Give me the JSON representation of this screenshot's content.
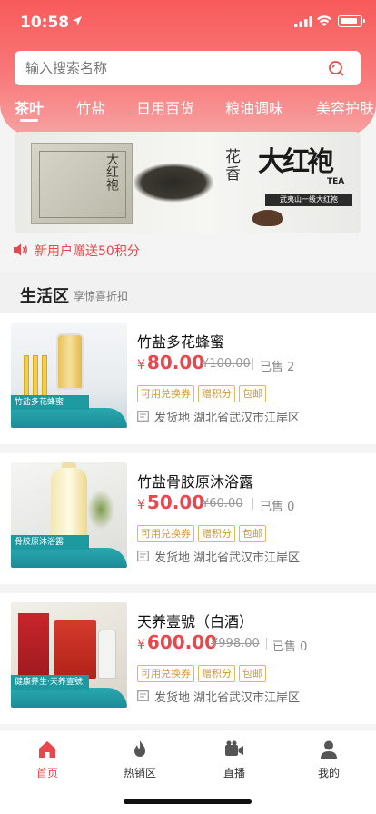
{
  "status_bar": {
    "time": "10:58"
  },
  "search": {
    "placeholder": "输入搜索名称"
  },
  "categories": [
    {
      "label": "茶叶",
      "active": true
    },
    {
      "label": "竹盐",
      "active": false
    },
    {
      "label": "日用百货",
      "active": false
    },
    {
      "label": "粮油调味",
      "active": false
    },
    {
      "label": "美容护肤",
      "active": false
    }
  ],
  "banner": {
    "box_text": "大红袍",
    "hua_text": "花香",
    "calligraphy": "大红袍",
    "tea_text": "TEA",
    "strip_text": "武夷山一级大红袍"
  },
  "promo": {
    "text": "新用户赠送50积分"
  },
  "section": {
    "title": "生活区",
    "subtitle": "享惊喜折扣"
  },
  "products": [
    {
      "name": "竹盐多花蜂蜜",
      "currency": "¥",
      "price": "80.00",
      "old_price": "¥100.00",
      "sold": "已售 2",
      "tags": [
        "可用兑换券",
        "赠积分",
        "包邮"
      ],
      "ship_label": "发货地",
      "ship_location": "湖北省武汉市江岸区",
      "image_caption": "竹盐多花蜂蜜"
    },
    {
      "name": "竹盐骨胶原沐浴露",
      "currency": "¥",
      "price": "50.00",
      "old_price": "¥60.00",
      "sold": "已售 0",
      "tags": [
        "可用兑换券",
        "赠积分",
        "包邮"
      ],
      "ship_label": "发货地",
      "ship_location": "湖北省武汉市江岸区",
      "image_caption": "骨胶原沐浴露"
    },
    {
      "name": "天养壹號（白酒）",
      "currency": "¥",
      "price": "600.00",
      "old_price": "¥998.00",
      "sold": "已售 0",
      "tags": [
        "可用兑换券",
        "赠积分",
        "包邮"
      ],
      "ship_label": "发货地",
      "ship_location": "湖北省武汉市江岸区",
      "image_caption": "健康养生·天养壹號"
    }
  ],
  "tab_bar": [
    {
      "label": "首页",
      "icon": "home-icon",
      "active": true
    },
    {
      "label": "热销区",
      "icon": "fire-icon",
      "active": false
    },
    {
      "label": "直播",
      "icon": "video-icon",
      "active": false
    },
    {
      "label": "我的",
      "icon": "person-icon",
      "active": false
    }
  ],
  "colors": {
    "accent": "#e8474c",
    "tag": "#c79a3a",
    "header": "#f85a5a"
  }
}
